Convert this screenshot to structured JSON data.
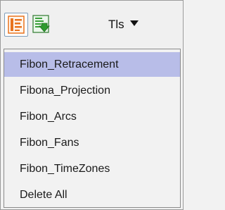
{
  "toolbar": {
    "fib_tool_icon": "fibonacci-lines-icon",
    "export_icon": "document-download-icon",
    "tools_label": "Tls",
    "tools_caret_icon": "caret-down-icon"
  },
  "menu": {
    "items": [
      {
        "label": "Fibon_Retracement",
        "active": true
      },
      {
        "label": "Fibona_Projection",
        "active": false
      },
      {
        "label": "Fibon_Arcs",
        "active": false
      },
      {
        "label": "Fibon_Fans",
        "active": false
      },
      {
        "label": "Fibon_TimeZones",
        "active": false
      },
      {
        "label": "Delete All",
        "active": false
      }
    ]
  },
  "colors": {
    "highlight": "#b8bde8",
    "icon_orange": "#e8731e",
    "icon_green": "#2e9a2e"
  }
}
